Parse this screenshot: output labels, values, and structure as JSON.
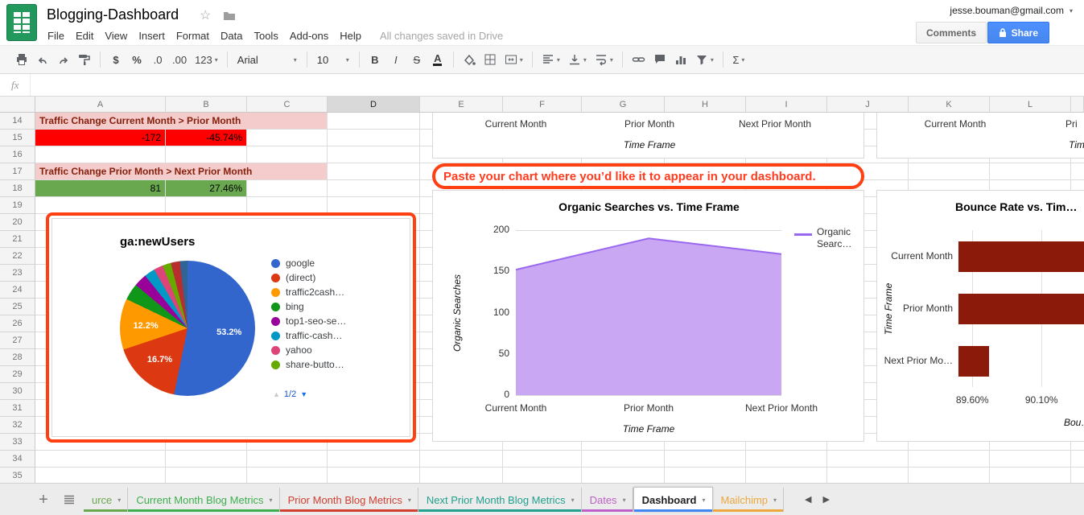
{
  "header": {
    "title": "Blogging-Dashboard",
    "account_email": "jesse.bouman@gmail.com",
    "comments_label": "Comments",
    "share_label": "Share"
  },
  "menu": {
    "items": [
      "File",
      "Edit",
      "View",
      "Insert",
      "Format",
      "Data",
      "Tools",
      "Add-ons",
      "Help"
    ],
    "save_status": "All changes saved in Drive"
  },
  "toolbar": {
    "currency_label": "$",
    "percent_label": "%",
    "decrease_decimals_label": ".0",
    "increase_decimals_label": ".00",
    "number_format_label": "123",
    "font_family_value": "Arial",
    "font_size_value": "10",
    "bold_label": "B",
    "italic_label": "I",
    "strikethrough_label": "S",
    "text_color_label": "A",
    "functions_label": "Σ"
  },
  "formula_bar": {
    "fx_label": "fx"
  },
  "grid": {
    "selected_column": "D",
    "first_row": 14,
    "visible_rows": 22,
    "columns": [
      "A",
      "B",
      "C",
      "D",
      "E",
      "F",
      "G",
      "H",
      "I",
      "J",
      "K",
      "L"
    ],
    "cells": [
      {
        "row": 14,
        "col": 0,
        "span": 3,
        "text": "Traffic Change Current Month > Prior Month",
        "bg": "#f4cccc",
        "color": "#85200c",
        "bold": true,
        "align": "left"
      },
      {
        "row": 15,
        "col": 0,
        "span": 1,
        "text": "-172",
        "bg": "#ff0000",
        "align": "right"
      },
      {
        "row": 15,
        "col": 1,
        "span": 1,
        "text": "-45.74%",
        "bg": "#ff0000",
        "align": "right"
      },
      {
        "row": 17,
        "col": 0,
        "span": 3,
        "text": "Traffic Change Prior Month > Next Prior Month",
        "bg": "#f4cccc",
        "color": "#85200c",
        "bold": true,
        "align": "left"
      },
      {
        "row": 18,
        "col": 0,
        "span": 1,
        "text": "81",
        "bg": "#6aa84f",
        "align": "right"
      },
      {
        "row": 18,
        "col": 1,
        "span": 1,
        "text": "27.46%",
        "bg": "#6aa84f",
        "align": "right"
      }
    ]
  },
  "annotations": {
    "callout_text": "Paste your chart where you’d like it to appear in your dashboard.",
    "highlight_color": "#ff4013"
  },
  "chart_data": [
    {
      "id": "traffic-sources-pie",
      "type": "pie",
      "title": "ga:newUsers",
      "slices": [
        {
          "label": "google",
          "pct": 53.2,
          "color": "#3366cc"
        },
        {
          "label": "(direct)",
          "pct": 16.7,
          "color": "#dc3912"
        },
        {
          "label": "traffic2cash…",
          "pct": 12.2,
          "color": "#ff9900"
        },
        {
          "label": "bing",
          "pct": 4.0,
          "color": "#109618"
        },
        {
          "label": "top1-seo-se…",
          "pct": 3.1,
          "color": "#990099"
        },
        {
          "label": "traffic-cash…",
          "pct": 2.6,
          "color": "#0099c6"
        },
        {
          "label": "yahoo",
          "pct": 2.2,
          "color": "#dd4477"
        },
        {
          "label": "share-butto…",
          "pct": 2.0,
          "color": "#66aa00"
        },
        {
          "label": "",
          "pct": 2.2,
          "color": "#b82e2e"
        },
        {
          "label": "",
          "pct": 1.8,
          "color": "#316395"
        }
      ],
      "legend_page": "1/2"
    },
    {
      "id": "fragment-top-middle",
      "type": "axis-fragment",
      "x_labels": [
        "Current Month",
        "Prior Month",
        "Next Prior Month"
      ],
      "x_title": "Time Frame"
    },
    {
      "id": "organic-searches-area",
      "type": "area",
      "title": "Organic Searches vs. Time Frame",
      "categories": [
        "Current Month",
        "Prior Month",
        "Next Prior Month"
      ],
      "series": [
        {
          "name": "Organic Searc…",
          "values": [
            152,
            190,
            171
          ]
        }
      ],
      "y_ticks": [
        0,
        50,
        100,
        150,
        200
      ],
      "y_max": 200,
      "y_title": "Organic Searches",
      "x_title": "Time Frame",
      "fill_color": "#c9a7f3",
      "line_color": "#9a67f0",
      "legend_lines": [
        "Organic",
        "Searc…"
      ]
    },
    {
      "id": "bounce-rate-hbar",
      "type": "bar-horizontal",
      "title": "Bounce Rate vs. Tim…",
      "categories": [
        "Current Month",
        "Prior Month",
        "Next Prior Mo…"
      ],
      "values": [
        90.55,
        90.52,
        89.72
      ],
      "x_min": 89.5,
      "x_ticks": [
        {
          "label": "89.60%",
          "value": 89.6
        },
        {
          "label": "90.10%",
          "value": 90.1
        }
      ],
      "bar_color": "#8c1a0a",
      "y_title": "Time Frame",
      "x_title_partial": "Bou…"
    },
    {
      "id": "fragment-top-right",
      "type": "axis-fragment",
      "x_labels": [
        "Current Month",
        "Pri"
      ],
      "x_title": "Tim"
    }
  ],
  "sheet_tabs": {
    "add_sheet_label": "+",
    "tabs": [
      {
        "label": "urce",
        "color": "#6aa84f",
        "active": false
      },
      {
        "label": "Current Month Blog Metrics",
        "color": "#3daf4e",
        "active": false
      },
      {
        "label": "Prior Month Blog Metrics",
        "color": "#d23f31",
        "active": false
      },
      {
        "label": "Next Prior Month Blog Metrics",
        "color": "#21a08d",
        "active": false
      },
      {
        "label": "Dates",
        "color": "#bd60c7",
        "active": false
      },
      {
        "label": "Dashboard",
        "color": "#4285f4",
        "active": true
      },
      {
        "label": "Mailchimp",
        "color": "#eda73c",
        "active": false
      }
    ]
  }
}
